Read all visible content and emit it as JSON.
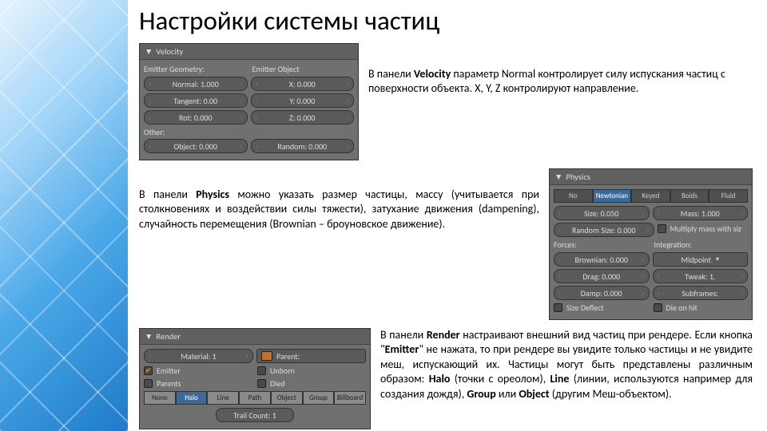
{
  "title": "Настройки системы частиц",
  "para1_a": "В панели ",
  "para1_b": " параметр Normal контролирует силу испускания частиц с поверхности объекта. X, Y, Z контролируют направление.",
  "para2_a": "В панели ",
  "para2_b": " можно указать размер частицы, массу (учитывается при столкновениях и воздействии силы тяжести), затухание движения (dampening), случайность перемещения (Brownian – броуновское движение).",
  "para3_a": "В панели ",
  "para3_b": " настраивают внешний вид частиц при рендере. Если кнопка \"",
  "para3_c": "\" не нажата, то при рендере вы увидите только частицы и не увидите меш, испускающий их. Частицы могут быть представлены различным образом: ",
  "para3_d": " (точки с ореолом), ",
  "para3_e": " (линии, используются например для создания дождя), ",
  "para3_f": " или ",
  "para3_g": " (другим Меш-объектом).",
  "bold": {
    "velocity": "Velocity",
    "physics": "Physics",
    "render": "Render",
    "emitter": "Emitter",
    "halo": "Halo",
    "line": "Line",
    "group": "Group",
    "object": "Object"
  },
  "velocity": {
    "header": "Velocity",
    "col1": "Emitter Geometry:",
    "col2": "Emitter Object",
    "normal": "Normal: 1.000",
    "tangent": "Tangent: 0.00",
    "rot": "Rot: 0.000",
    "x": "X: 0.000",
    "y": "Y: 0.000",
    "z": "Z: 0.000",
    "other": "Other:",
    "object": "Object: 0.000",
    "random": "Random: 0.000"
  },
  "physics": {
    "header": "Physics",
    "tabs": [
      "No",
      "Newtonian",
      "Keyed",
      "Boids",
      "Fluid"
    ],
    "size": "Size: 0.050",
    "mass": "Mass: 1.000",
    "rsize": "Random Size: 0.000",
    "mult": "Multiply mass with siz",
    "forces": "Forces:",
    "integration": "Integration:",
    "brownian": "Brownian: 0.000",
    "midpoint": "Midpoint",
    "drag": "Drag: 0.000",
    "tweak": "Tweak: 1.",
    "damp": "Damp: 0.000",
    "subframes": "Subframes:",
    "sizedef": "Size Deflect",
    "diehit": "Die on hit"
  },
  "render": {
    "header": "Render",
    "material": "Material: 1",
    "parent": "Parent:",
    "emitter": "Emitter",
    "unborn": "Unborn",
    "parents": "Parents",
    "died": "Died",
    "tabs": [
      "None",
      "Halo",
      "Line",
      "Path",
      "Object",
      "Group",
      "Billboard"
    ],
    "trail": "Trail Count: 1"
  }
}
